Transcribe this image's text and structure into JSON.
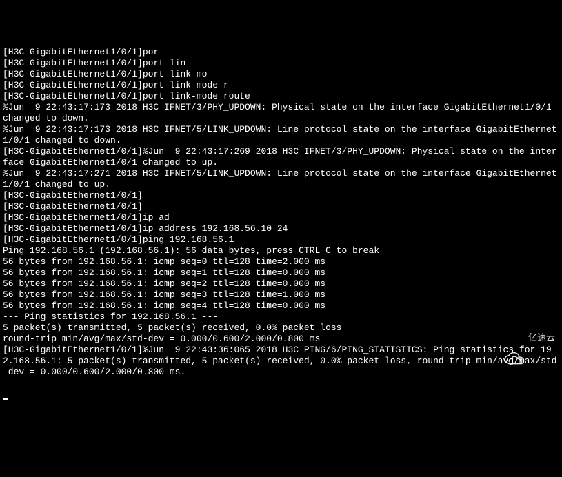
{
  "terminal": {
    "lines": [
      "[H3C-GigabitEthernet1/0/1]por",
      "[H3C-GigabitEthernet1/0/1]port lin",
      "[H3C-GigabitEthernet1/0/1]port link-mo",
      "[H3C-GigabitEthernet1/0/1]port link-mode r",
      "[H3C-GigabitEthernet1/0/1]port link-mode route",
      "%Jun  9 22:43:17:173 2018 H3C IFNET/3/PHY_UPDOWN: Physical state on the interface GigabitEthernet1/0/1 changed to down.",
      "%Jun  9 22:43:17:173 2018 H3C IFNET/5/LINK_UPDOWN: Line protocol state on the interface GigabitEthernet1/0/1 changed to down.",
      "[H3C-GigabitEthernet1/0/1]%Jun  9 22:43:17:269 2018 H3C IFNET/3/PHY_UPDOWN: Physical state on the interface GigabitEthernet1/0/1 changed to up.",
      "%Jun  9 22:43:17:271 2018 H3C IFNET/5/LINK_UPDOWN: Line protocol state on the interface GigabitEthernet1/0/1 changed to up.",
      "",
      "[H3C-GigabitEthernet1/0/1]",
      "[H3C-GigabitEthernet1/0/1]",
      "[H3C-GigabitEthernet1/0/1]ip ad",
      "[H3C-GigabitEthernet1/0/1]ip address 192.168.56.10 24",
      "[H3C-GigabitEthernet1/0/1]ping 192.168.56.1",
      "Ping 192.168.56.1 (192.168.56.1): 56 data bytes, press CTRL_C to break",
      "56 bytes from 192.168.56.1: icmp_seq=0 ttl=128 time=2.000 ms",
      "56 bytes from 192.168.56.1: icmp_seq=1 ttl=128 time=0.000 ms",
      "56 bytes from 192.168.56.1: icmp_seq=2 ttl=128 time=0.000 ms",
      "56 bytes from 192.168.56.1: icmp_seq=3 ttl=128 time=1.000 ms",
      "56 bytes from 192.168.56.1: icmp_seq=4 ttl=128 time=0.000 ms",
      "",
      "--- Ping statistics for 192.168.56.1 ---",
      "5 packet(s) transmitted, 5 packet(s) received, 0.0% packet loss",
      "round-trip min/avg/max/std-dev = 0.000/0.600/2.000/0.800 ms",
      "[H3C-GigabitEthernet1/0/1]%Jun  9 22:43:36:065 2018 H3C PING/6/PING_STATISTICS: Ping statistics for 192.168.56.1: 5 packet(s) transmitted, 5 packet(s) received, 0.0% packet loss, round-trip min/avg/max/std-dev = 0.000/0.600/2.000/0.800 ms."
    ]
  },
  "watermark": {
    "text": "亿速云"
  }
}
